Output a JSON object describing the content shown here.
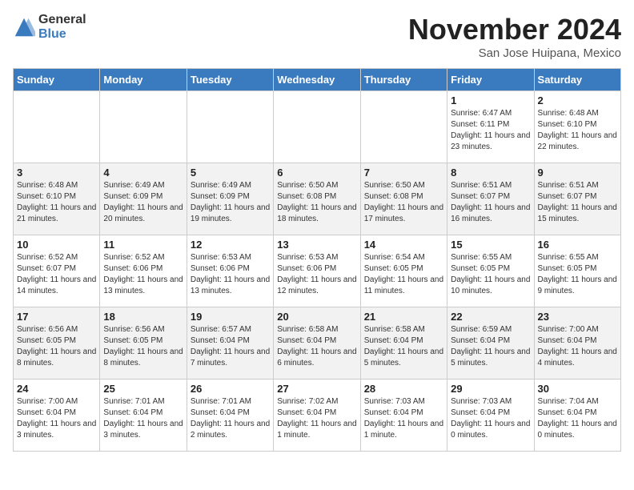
{
  "header": {
    "logo_general": "General",
    "logo_blue": "Blue",
    "month_title": "November 2024",
    "location": "San Jose Huipana, Mexico"
  },
  "weekdays": [
    "Sunday",
    "Monday",
    "Tuesday",
    "Wednesday",
    "Thursday",
    "Friday",
    "Saturday"
  ],
  "weeks": [
    [
      {
        "day": "",
        "info": ""
      },
      {
        "day": "",
        "info": ""
      },
      {
        "day": "",
        "info": ""
      },
      {
        "day": "",
        "info": ""
      },
      {
        "day": "",
        "info": ""
      },
      {
        "day": "1",
        "info": "Sunrise: 6:47 AM\nSunset: 6:11 PM\nDaylight: 11 hours and 23 minutes."
      },
      {
        "day": "2",
        "info": "Sunrise: 6:48 AM\nSunset: 6:10 PM\nDaylight: 11 hours and 22 minutes."
      }
    ],
    [
      {
        "day": "3",
        "info": "Sunrise: 6:48 AM\nSunset: 6:10 PM\nDaylight: 11 hours and 21 minutes."
      },
      {
        "day": "4",
        "info": "Sunrise: 6:49 AM\nSunset: 6:09 PM\nDaylight: 11 hours and 20 minutes."
      },
      {
        "day": "5",
        "info": "Sunrise: 6:49 AM\nSunset: 6:09 PM\nDaylight: 11 hours and 19 minutes."
      },
      {
        "day": "6",
        "info": "Sunrise: 6:50 AM\nSunset: 6:08 PM\nDaylight: 11 hours and 18 minutes."
      },
      {
        "day": "7",
        "info": "Sunrise: 6:50 AM\nSunset: 6:08 PM\nDaylight: 11 hours and 17 minutes."
      },
      {
        "day": "8",
        "info": "Sunrise: 6:51 AM\nSunset: 6:07 PM\nDaylight: 11 hours and 16 minutes."
      },
      {
        "day": "9",
        "info": "Sunrise: 6:51 AM\nSunset: 6:07 PM\nDaylight: 11 hours and 15 minutes."
      }
    ],
    [
      {
        "day": "10",
        "info": "Sunrise: 6:52 AM\nSunset: 6:07 PM\nDaylight: 11 hours and 14 minutes."
      },
      {
        "day": "11",
        "info": "Sunrise: 6:52 AM\nSunset: 6:06 PM\nDaylight: 11 hours and 13 minutes."
      },
      {
        "day": "12",
        "info": "Sunrise: 6:53 AM\nSunset: 6:06 PM\nDaylight: 11 hours and 13 minutes."
      },
      {
        "day": "13",
        "info": "Sunrise: 6:53 AM\nSunset: 6:06 PM\nDaylight: 11 hours and 12 minutes."
      },
      {
        "day": "14",
        "info": "Sunrise: 6:54 AM\nSunset: 6:05 PM\nDaylight: 11 hours and 11 minutes."
      },
      {
        "day": "15",
        "info": "Sunrise: 6:55 AM\nSunset: 6:05 PM\nDaylight: 11 hours and 10 minutes."
      },
      {
        "day": "16",
        "info": "Sunrise: 6:55 AM\nSunset: 6:05 PM\nDaylight: 11 hours and 9 minutes."
      }
    ],
    [
      {
        "day": "17",
        "info": "Sunrise: 6:56 AM\nSunset: 6:05 PM\nDaylight: 11 hours and 8 minutes."
      },
      {
        "day": "18",
        "info": "Sunrise: 6:56 AM\nSunset: 6:05 PM\nDaylight: 11 hours and 8 minutes."
      },
      {
        "day": "19",
        "info": "Sunrise: 6:57 AM\nSunset: 6:04 PM\nDaylight: 11 hours and 7 minutes."
      },
      {
        "day": "20",
        "info": "Sunrise: 6:58 AM\nSunset: 6:04 PM\nDaylight: 11 hours and 6 minutes."
      },
      {
        "day": "21",
        "info": "Sunrise: 6:58 AM\nSunset: 6:04 PM\nDaylight: 11 hours and 5 minutes."
      },
      {
        "day": "22",
        "info": "Sunrise: 6:59 AM\nSunset: 6:04 PM\nDaylight: 11 hours and 5 minutes."
      },
      {
        "day": "23",
        "info": "Sunrise: 7:00 AM\nSunset: 6:04 PM\nDaylight: 11 hours and 4 minutes."
      }
    ],
    [
      {
        "day": "24",
        "info": "Sunrise: 7:00 AM\nSunset: 6:04 PM\nDaylight: 11 hours and 3 minutes."
      },
      {
        "day": "25",
        "info": "Sunrise: 7:01 AM\nSunset: 6:04 PM\nDaylight: 11 hours and 3 minutes."
      },
      {
        "day": "26",
        "info": "Sunrise: 7:01 AM\nSunset: 6:04 PM\nDaylight: 11 hours and 2 minutes."
      },
      {
        "day": "27",
        "info": "Sunrise: 7:02 AM\nSunset: 6:04 PM\nDaylight: 11 hours and 1 minute."
      },
      {
        "day": "28",
        "info": "Sunrise: 7:03 AM\nSunset: 6:04 PM\nDaylight: 11 hours and 1 minute."
      },
      {
        "day": "29",
        "info": "Sunrise: 7:03 AM\nSunset: 6:04 PM\nDaylight: 11 hours and 0 minutes."
      },
      {
        "day": "30",
        "info": "Sunrise: 7:04 AM\nSunset: 6:04 PM\nDaylight: 11 hours and 0 minutes."
      }
    ]
  ]
}
